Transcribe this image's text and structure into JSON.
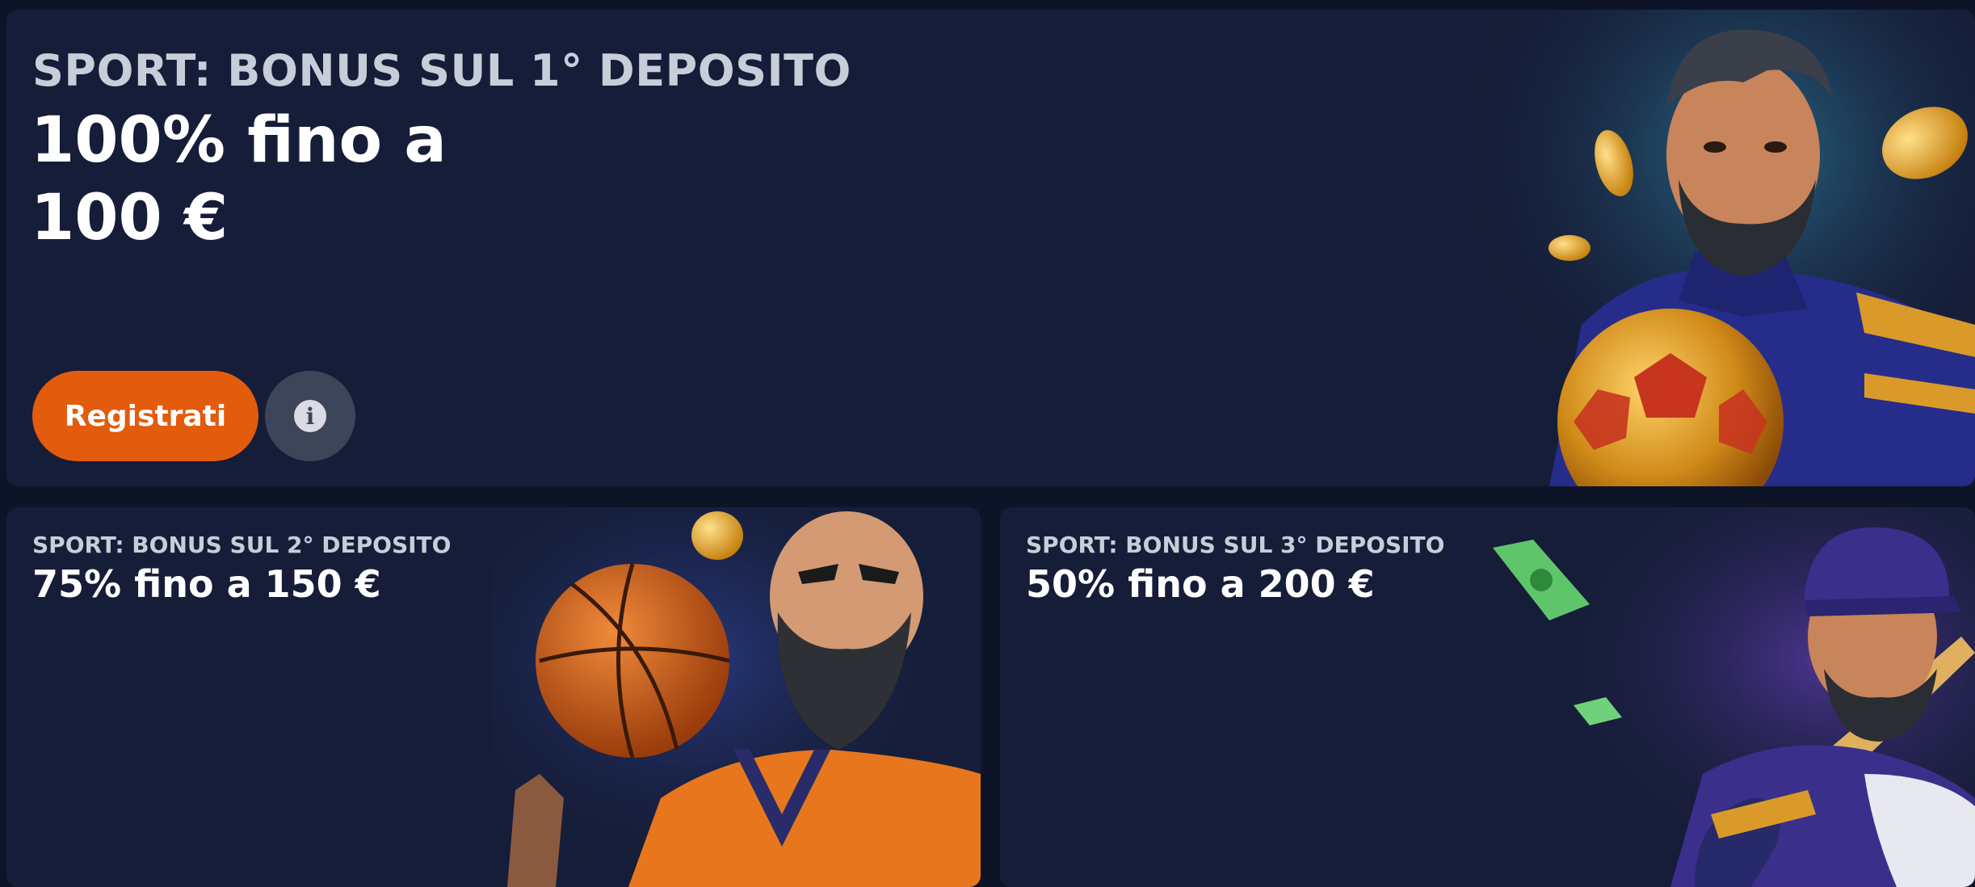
{
  "cards": [
    {
      "eyebrow": "SPORT: BONUS SUL 1° DEPOSITO",
      "headline_line1": "100% fino a",
      "headline_line2": "100 €",
      "register_label": "Registrati",
      "info_glyph": "i",
      "illustration": "soccer-player"
    },
    {
      "eyebrow": "SPORT: BONUS SUL 2° DEPOSITO",
      "headline": "75% fino a 150 €",
      "illustration": "basketball-player"
    },
    {
      "eyebrow": "SPORT: BONUS SUL 3° DEPOSITO",
      "headline": "50% fino a 200 €",
      "illustration": "baseball-player"
    }
  ],
  "colors": {
    "page_bg": "#0e1428",
    "card_bg": "#161d38",
    "accent": "#e35b0c",
    "info_button": "#3d4559"
  }
}
